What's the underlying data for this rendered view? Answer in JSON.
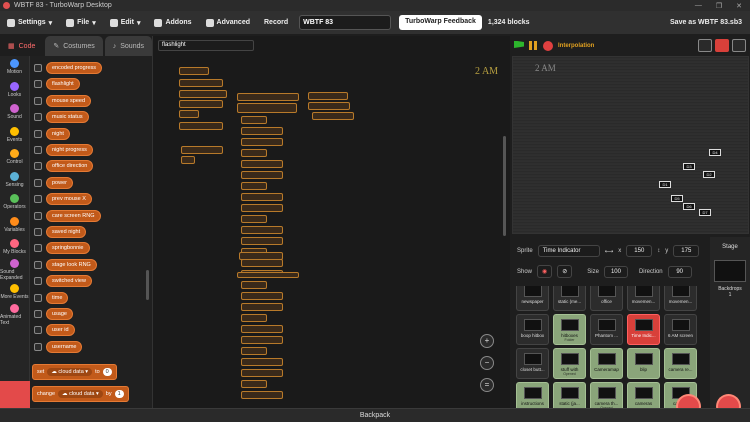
{
  "window": {
    "title": "WBTF 83 - TurboWarp Desktop",
    "controls": [
      "—",
      "❐",
      "✕"
    ]
  },
  "menu": {
    "settings": "Settings",
    "file": "File",
    "edit": "Edit",
    "addons": "Addons",
    "advanced": "Advanced",
    "record": "Record",
    "project_title": "WBTF 83",
    "feedback": "TurboWarp Feedback",
    "block_count": "1,324 blocks",
    "save": "Save as WBTF 83.sb3"
  },
  "tabs": [
    {
      "label": "Code"
    },
    {
      "label": "Costumes"
    },
    {
      "label": "Sounds"
    }
  ],
  "categories": [
    {
      "label": "Motion",
      "color": "#4c97ff"
    },
    {
      "label": "Looks",
      "color": "#9966ff"
    },
    {
      "label": "Sound",
      "color": "#cf63cf"
    },
    {
      "label": "Events",
      "color": "#ffbf00"
    },
    {
      "label": "Control",
      "color": "#ffab19"
    },
    {
      "label": "Sensing",
      "color": "#5cb1d6"
    },
    {
      "label": "Operators",
      "color": "#59c059"
    },
    {
      "label": "Variables",
      "color": "#ff8c1a"
    },
    {
      "label": "My Blocks",
      "color": "#ff6680"
    },
    {
      "label": "Sound Expanded",
      "color": "#cf63cf"
    },
    {
      "label": "More Events",
      "color": "#ffbf00"
    },
    {
      "label": "Animated Text",
      "color": "#ff6b9e"
    }
  ],
  "variables": [
    "encoded progress",
    "flashlight",
    "mouse speed",
    "music status",
    "night",
    "night progress",
    "office direction",
    "power",
    "prev mouse X",
    "care screen RNG",
    "saved night",
    "springbonnie",
    "stage look RNG",
    "switched view",
    "time",
    "usage",
    "user id",
    "username"
  ],
  "set_block": {
    "verb": "set",
    "var": "cloud data",
    "to": "to",
    "value": "0"
  },
  "change_block": {
    "verb": "change",
    "var": "cloud data",
    "by": "by",
    "value": "1"
  },
  "workspace": {
    "sprite_field": "flashlight",
    "watermark": "2 AM"
  },
  "stagebar": {
    "interpolation": "Interpolation"
  },
  "stage": {
    "time_overlay": "2 AM",
    "cams": [
      "D4",
      "D3",
      "D2",
      "D1",
      "D5",
      "D6",
      "D7"
    ]
  },
  "sprite_info": {
    "sprite_label": "Sprite",
    "sprite_name": "Time Indicator",
    "x_label": "x",
    "x": "150",
    "y_label": "y",
    "y": "175",
    "show_label": "Show",
    "size_label": "Size",
    "size": "100",
    "direction_label": "Direction",
    "direction": "90"
  },
  "stage_panel": {
    "label": "Stage",
    "backdrops_label": "Backdrops",
    "backdrops": "1"
  },
  "sprites": [
    {
      "name": "newspaper",
      "sub": ""
    },
    {
      "name": "static (me...",
      "sub": ""
    },
    {
      "name": "office",
      "sub": ""
    },
    {
      "name": "movemen...",
      "sub": ""
    },
    {
      "name": "movemen...",
      "sub": ""
    },
    {
      "name": "boop hitbox",
      "sub": ""
    },
    {
      "name": "hitboxes",
      "sub": "Folder"
    },
    {
      "name": "Phantom ...",
      "sub": ""
    },
    {
      "name": "Time Indic...",
      "sub": ""
    },
    {
      "name": "6 AM screen",
      "sub": ""
    },
    {
      "name": "closet butt...",
      "sub": ""
    },
    {
      "name": "stuff with",
      "sub": "Opened"
    },
    {
      "name": "Cameramap",
      "sub": ""
    },
    {
      "name": "blip",
      "sub": ""
    },
    {
      "name": "camera re...",
      "sub": ""
    },
    {
      "name": "instructions",
      "sub": ""
    },
    {
      "name": "static (ja...",
      "sub": ""
    },
    {
      "name": "camera th...",
      "sub": "Opened"
    },
    {
      "name": "cameras",
      "sub": ""
    },
    {
      "name": "camera",
      "sub": ""
    }
  ],
  "backpack": "Backpack"
}
